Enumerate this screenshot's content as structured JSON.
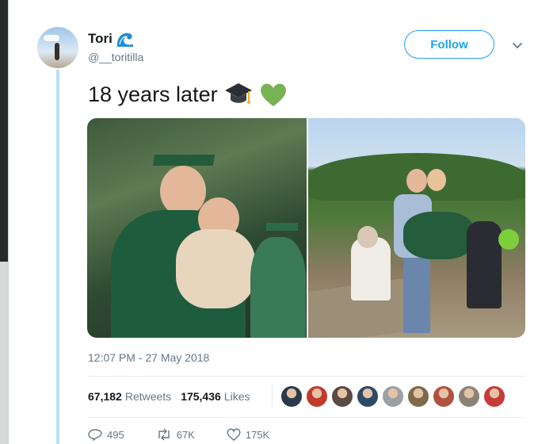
{
  "user": {
    "display_name": "Tori",
    "handle": "@__toritilla",
    "name_emoji_icon": "water-wave-icon"
  },
  "follow": {
    "label": "Follow"
  },
  "menu": {
    "icon": "chevron-down-icon"
  },
  "tweet": {
    "text": "18 years later",
    "emojis": [
      "graduation-cap-icon",
      "green-heart-icon"
    ],
    "timestamp": "12:07 PM - 27 May 2018"
  },
  "media": {
    "photos": [
      "graduation-photo-2000",
      "graduation-photo-2018"
    ]
  },
  "stats": {
    "retweets_count": "67,182",
    "retweets_label": "Retweets",
    "likes_count": "175,436",
    "likes_label": "Likes"
  },
  "likers": {
    "count": 9,
    "colors": [
      "#2b3a4a",
      "#c23a2c",
      "#5a4a44",
      "#2c4a66",
      "#9aa0a6",
      "#7d6a48",
      "#b0523f",
      "#8a8478",
      "#c93a3a"
    ]
  },
  "actions": {
    "reply_count": "495",
    "retweet_count": "67K",
    "like_count": "175K"
  },
  "colors": {
    "accent": "#1da1f2",
    "thread_line": "#b7dff7",
    "text_primary": "#14171a",
    "text_secondary": "#657786"
  }
}
